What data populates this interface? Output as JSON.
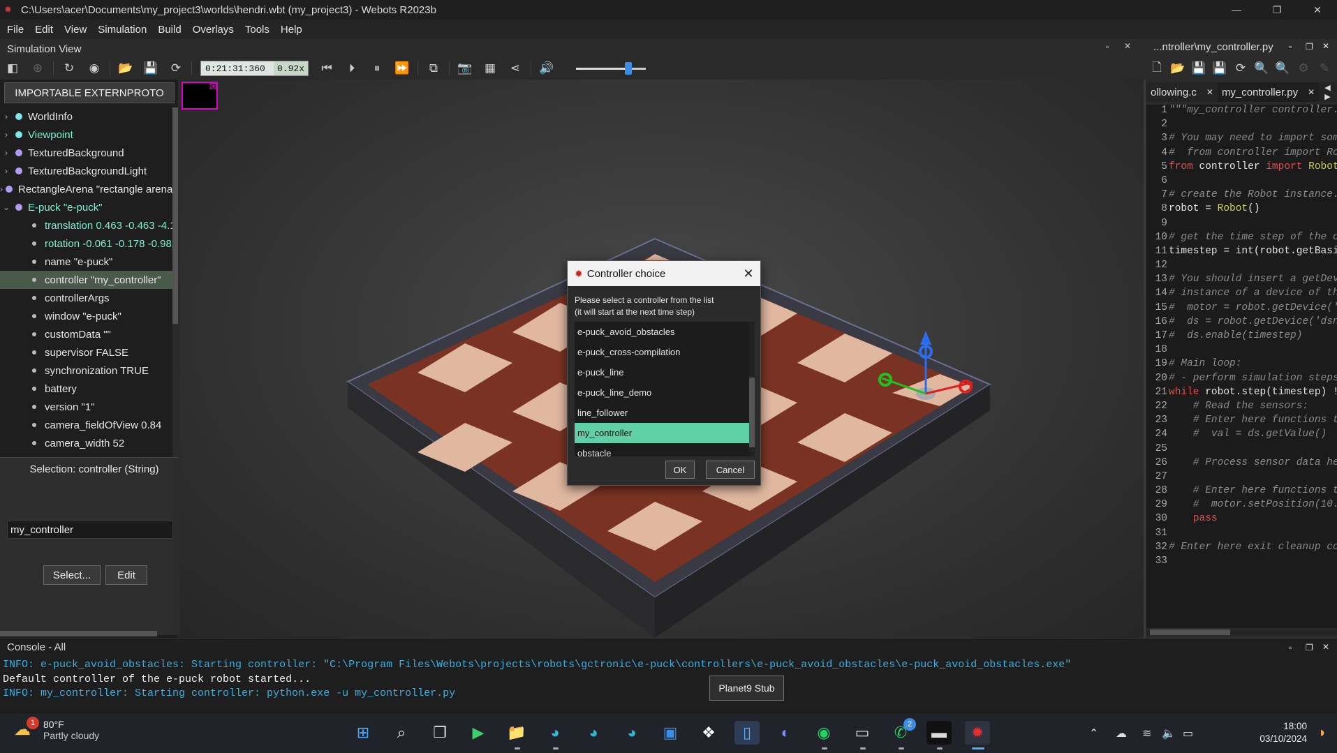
{
  "window": {
    "title": "C:\\Users\\acer\\Documents\\my_project3\\worlds\\hendri.wbt (my_project3) - Webots R2023b"
  },
  "menu": [
    "File",
    "Edit",
    "View",
    "Simulation",
    "Build",
    "Overlays",
    "Tools",
    "Help"
  ],
  "simulation_view": {
    "title": "Simulation View",
    "time": "0:21:31:360",
    "speed": "0.92x",
    "volume_level": 0.75
  },
  "scene_tree": {
    "externproto_button": "IMPORTABLE EXTERNPROTO",
    "nodes": [
      {
        "label": "WorldInfo",
        "dot": "cyan",
        "expand": "›",
        "highlight": false
      },
      {
        "label": "Viewpoint",
        "dot": "cyan",
        "expand": "›",
        "highlight": true
      },
      {
        "label": "TexturedBackground",
        "dot": "purple",
        "expand": "›",
        "highlight": false
      },
      {
        "label": "TexturedBackgroundLight",
        "dot": "purple",
        "expand": "›",
        "highlight": false
      },
      {
        "label": "RectangleArena \"rectangle arena\"",
        "dot": "purple",
        "expand": "›",
        "highlight": false
      },
      {
        "label": "E-puck \"e-puck\"",
        "dot": "purple",
        "expand": "⌄",
        "highlight": true
      }
    ],
    "fields": [
      {
        "label": "translation 0.463 -0.463 -4.1",
        "highlight": true,
        "selected": false
      },
      {
        "label": "rotation -0.061 -0.178 -0.982",
        "highlight": true,
        "selected": false
      },
      {
        "label": "name \"e-puck\"",
        "highlight": false,
        "selected": false
      },
      {
        "label": "controller \"my_controller\"",
        "highlight": false,
        "selected": true
      },
      {
        "label": "controllerArgs",
        "highlight": false,
        "selected": false
      },
      {
        "label": "window \"e-puck\"",
        "highlight": false,
        "selected": false
      },
      {
        "label": "customData \"\"",
        "highlight": false,
        "selected": false
      },
      {
        "label": "supervisor FALSE",
        "highlight": false,
        "selected": false
      },
      {
        "label": "synchronization TRUE",
        "highlight": false,
        "selected": false
      },
      {
        "label": "battery",
        "highlight": false,
        "selected": false
      },
      {
        "label": "version \"1\"",
        "highlight": false,
        "selected": false
      },
      {
        "label": "camera_fieldOfView 0.84",
        "highlight": false,
        "selected": false
      },
      {
        "label": "camera_width 52",
        "highlight": false,
        "selected": false
      }
    ]
  },
  "field_editor": {
    "selection": "Selection: controller (String)",
    "value": "my_controller",
    "select_button": "Select...",
    "edit_button": "Edit"
  },
  "dialog": {
    "title": "Controller choice",
    "message_line1": "Please select a controller from the list",
    "message_line2": "(it will start at the next time step)",
    "items": [
      "e-puck_avoid_obstacles",
      "e-puck_cross-compilation",
      "e-puck_line",
      "e-puck_line_demo",
      "line_follower",
      "my_controller",
      "obstacle"
    ],
    "selected": "my_controller",
    "ok": "OK",
    "cancel": "Cancel"
  },
  "editor": {
    "header": "...ntroller\\my_controller.py",
    "tabs": [
      {
        "label": "ollowing.c",
        "close": "✕",
        "active": false
      },
      {
        "label": "my_controller.py",
        "close": "✕",
        "active": true
      }
    ],
    "lines": [
      {
        "n": "1",
        "parts": [
          {
            "t": "\"\"\"my_controller controller.",
            "c": "com"
          }
        ]
      },
      {
        "n": "2",
        "parts": []
      },
      {
        "n": "3",
        "parts": [
          {
            "t": "# You may need to import som",
            "c": "com"
          }
        ]
      },
      {
        "n": "4",
        "parts": [
          {
            "t": "#  from controller import Ro",
            "c": "com"
          }
        ]
      },
      {
        "n": "5",
        "parts": [
          {
            "t": "from",
            "c": "kw"
          },
          {
            "t": " controller ",
            "c": ""
          },
          {
            "t": "import",
            "c": "kw"
          },
          {
            "t": " Robot",
            "c": "cls"
          }
        ]
      },
      {
        "n": "6",
        "parts": []
      },
      {
        "n": "7",
        "parts": [
          {
            "t": "# create the Robot instance.",
            "c": "com"
          }
        ]
      },
      {
        "n": "8",
        "parts": [
          {
            "t": "robot = ",
            "c": ""
          },
          {
            "t": "Robot",
            "c": "cls"
          },
          {
            "t": "()",
            "c": ""
          }
        ]
      },
      {
        "n": "9",
        "parts": []
      },
      {
        "n": "10",
        "parts": [
          {
            "t": "# get the time step of the c",
            "c": "com"
          }
        ]
      },
      {
        "n": "11",
        "parts": [
          {
            "t": "timestep = int(robot.getBasi",
            "c": ""
          }
        ]
      },
      {
        "n": "12",
        "parts": []
      },
      {
        "n": "13",
        "parts": [
          {
            "t": "# You should insert a getDev",
            "c": "com"
          }
        ]
      },
      {
        "n": "14",
        "parts": [
          {
            "t": "# instance of a device of th",
            "c": "com"
          }
        ]
      },
      {
        "n": "15",
        "parts": [
          {
            "t": "#  motor = robot.getDevice('",
            "c": "com"
          }
        ]
      },
      {
        "n": "16",
        "parts": [
          {
            "t": "#  ds = robot.getDevice('dsn",
            "c": "com"
          }
        ]
      },
      {
        "n": "17",
        "parts": [
          {
            "t": "#  ds.enable(timestep)",
            "c": "com"
          }
        ]
      },
      {
        "n": "18",
        "parts": []
      },
      {
        "n": "19",
        "parts": [
          {
            "t": "# Main loop:",
            "c": "com"
          }
        ]
      },
      {
        "n": "20",
        "parts": [
          {
            "t": "# - perform simulation steps",
            "c": "com"
          }
        ]
      },
      {
        "n": "21",
        "parts": [
          {
            "t": "while",
            "c": "kw"
          },
          {
            "t": " robot.step(timestep) !",
            "c": ""
          }
        ]
      },
      {
        "n": "22",
        "parts": [
          {
            "t": "    # Read the sensors:",
            "c": "com"
          }
        ]
      },
      {
        "n": "23",
        "parts": [
          {
            "t": "    # Enter here functions t",
            "c": "com"
          }
        ]
      },
      {
        "n": "24",
        "parts": [
          {
            "t": "    #  val = ds.getValue()",
            "c": "com"
          }
        ]
      },
      {
        "n": "25",
        "parts": []
      },
      {
        "n": "26",
        "parts": [
          {
            "t": "    # Process sensor data he",
            "c": "com"
          }
        ]
      },
      {
        "n": "27",
        "parts": []
      },
      {
        "n": "28",
        "parts": [
          {
            "t": "    # Enter here functions t",
            "c": "com"
          }
        ]
      },
      {
        "n": "29",
        "parts": [
          {
            "t": "    #  motor.setPosition(10.",
            "c": "com"
          }
        ]
      },
      {
        "n": "30",
        "parts": [
          {
            "t": "    ",
            "c": ""
          },
          {
            "t": "pass",
            "c": "kw"
          }
        ]
      },
      {
        "n": "31",
        "parts": []
      },
      {
        "n": "32",
        "parts": [
          {
            "t": "# Enter here exit cleanup co",
            "c": "com"
          }
        ]
      },
      {
        "n": "33",
        "parts": []
      }
    ]
  },
  "console": {
    "title": "Console - All",
    "lines": [
      {
        "text": "INFO: e-puck_avoid_obstacles: Starting controller: \"C:\\Program Files\\Webots\\projects\\robots\\gctronic\\e-puck\\controllers\\e-puck_avoid_obstacles\\e-puck_avoid_obstacles.exe\"",
        "kind": "info"
      },
      {
        "text": "Default controller of the e-puck robot started...",
        "kind": "plain"
      },
      {
        "text": "INFO: my_controller: Starting controller: python.exe -u my_controller.py",
        "kind": "info"
      }
    ]
  },
  "tooltip": "Planet9 Stub",
  "taskbar": {
    "weather_temp": "80°F",
    "weather_cond": "Partly cloudy",
    "weather_badge": "1",
    "whatsapp_badge": "2",
    "time": "18:00",
    "date": "03/10/2024"
  },
  "colors": {
    "accent_green": "#5fd0a8",
    "tree_highlight": "#7df0d2",
    "console_info": "#38b0e0",
    "keyword": "#e05050"
  }
}
